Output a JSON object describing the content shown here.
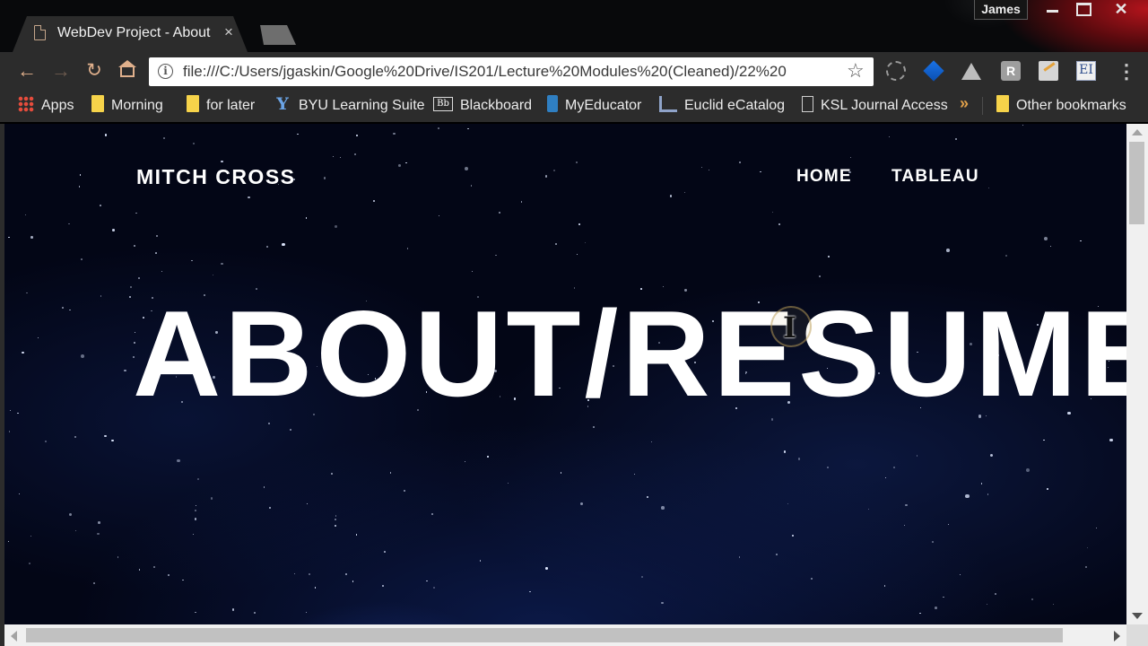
{
  "browser": {
    "tab": {
      "title": "WebDev Project - About",
      "close": "×"
    },
    "profile": "James",
    "window_controls": {
      "close": "✕"
    },
    "nav": {
      "back": "←",
      "forward": "→",
      "reload": "↻"
    },
    "address": {
      "info": "i",
      "url": "file:///C:/Users/jgaskin/Google%20Drive/IS201/Lecture%20Modules%20(Cleaned)/22%20",
      "star": "☆"
    },
    "extensions": [
      {
        "icon": "shield-icon"
      },
      {
        "icon": "diamond-extension-icon"
      },
      {
        "icon": "drive-icon"
      },
      {
        "icon": "r-extension-icon",
        "glyph": "R"
      },
      {
        "icon": "notes-extension-icon"
      },
      {
        "icon": "ei-extension-icon",
        "glyph": "EI"
      }
    ],
    "menu": "⋮",
    "bookmarks": [
      {
        "label": "Apps",
        "icon": "apps-grid-icon"
      },
      {
        "label": "Morning",
        "icon": "folder-icon"
      },
      {
        "label": "for later",
        "icon": "folder-icon"
      },
      {
        "label": "BYU Learning Suite",
        "icon": "byu-icon",
        "glyph": "Y"
      },
      {
        "label": "Blackboard",
        "icon": "blackboard-icon",
        "glyph": "Bb"
      },
      {
        "label": "MyEducator",
        "icon": "myeducator-icon"
      },
      {
        "label": "Euclid eCatalog",
        "icon": "euclid-icon"
      },
      {
        "label": "KSL Journal Access",
        "icon": "document-icon"
      }
    ],
    "bookmarks_more": "»",
    "other_bookmarks": "Other bookmarks"
  },
  "page": {
    "logo": "MITCH CROSS",
    "nav": [
      "HOME",
      "TABLEAU"
    ],
    "hero": "ABOUT/RESUME"
  },
  "colors": {
    "chrome_bg": "#2c2c2c",
    "accent_orange": "#e0b08c",
    "hero_bg": "#030616",
    "hero_text": "#ffffff"
  }
}
